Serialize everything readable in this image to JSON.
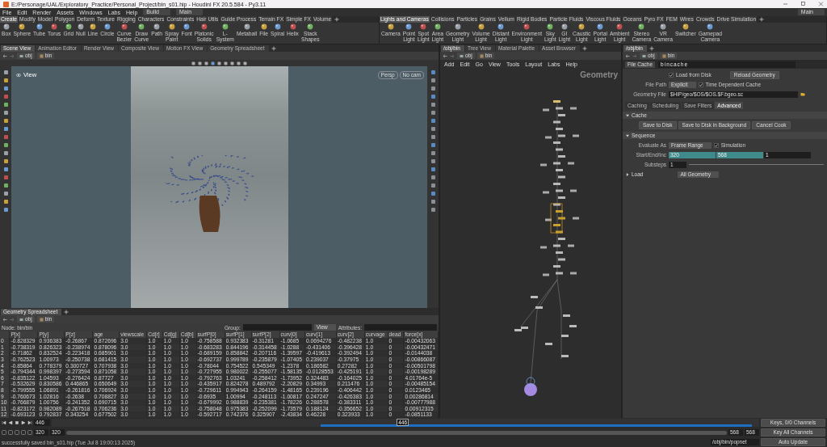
{
  "window": {
    "title": "E:/Personage/UAL/Exploratory_Practice/Personal_Project/bin_s01.hip - Houdini FX 20.5.584 - Py3.11"
  },
  "menu_bar": {
    "items": [
      "File",
      "Edit",
      "Render",
      "Assets",
      "Windows",
      "Labs",
      "Help"
    ],
    "desktop": "Build",
    "main_left": "Main",
    "main_right": "Main"
  },
  "shelves": [
    {
      "tabs": [
        {
          "label": "Create",
          "selected": true
        },
        {
          "label": "Modify",
          "selected": false
        },
        {
          "label": "Model",
          "selected": false
        },
        {
          "label": "Polygon",
          "selected": false
        },
        {
          "label": "Deform",
          "selected": false
        },
        {
          "label": "Texture",
          "selected": false
        },
        {
          "label": "Rigging",
          "selected": false
        },
        {
          "label": "Characters",
          "selected": false
        },
        {
          "label": "Constraints",
          "selected": false
        },
        {
          "label": "Hair Utils",
          "selected": false
        },
        {
          "label": "Guide Process",
          "selected": false
        },
        {
          "label": "Terrain FX",
          "selected": false
        },
        {
          "label": "Simple FX",
          "selected": false
        },
        {
          "label": "Volume",
          "selected": false
        }
      ],
      "tools": [
        "Box",
        "Sphere",
        "Tube",
        "Torus",
        "Grid",
        "Null",
        "Line",
        "Circle",
        "Curve Bezier",
        "Draw Curve",
        "Path",
        "Spray Paint",
        "Font",
        "Platonic Solids",
        "L-System",
        "Metaball",
        "File",
        "Spiral",
        "Helix",
        "Stack Shapes"
      ]
    },
    {
      "tabs": [
        {
          "label": "Lights and Cameras",
          "selected": true
        },
        {
          "label": "Collisions",
          "selected": false
        },
        {
          "label": "Particles",
          "selected": false
        },
        {
          "label": "Grains",
          "selected": false
        },
        {
          "label": "Vellum",
          "selected": false
        },
        {
          "label": "Rigid Bodies",
          "selected": false
        },
        {
          "label": "Particle Fluids",
          "selected": false
        },
        {
          "label": "Viscous Fluids",
          "selected": false
        },
        {
          "label": "Oceans",
          "selected": false
        },
        {
          "label": "Pyro FX",
          "selected": false
        },
        {
          "label": "FEM",
          "selected": false
        },
        {
          "label": "Wires",
          "selected": false
        },
        {
          "label": "Crowds",
          "selected": false
        },
        {
          "label": "Drive Simulation",
          "selected": false
        }
      ],
      "tools": [
        "Camera",
        "Point Light",
        "Spot Light",
        "Area Light",
        "Geometry Light",
        "Volume Light",
        "Distant Light",
        "Environment Light",
        "Sky Light",
        "GI Light",
        "Caustic Light",
        "Portal Light",
        "Ambient Light",
        "Stereo Camera",
        "VR Camera",
        "Switcher",
        "Gamepad Camera"
      ]
    }
  ],
  "scene_pane": {
    "tabs": [
      {
        "label": "Scene View",
        "selected": true
      },
      {
        "label": "Animation Editor",
        "selected": false
      },
      {
        "label": "Render View",
        "selected": false
      },
      {
        "label": "Composite View",
        "selected": false
      },
      {
        "label": "Motion FX View",
        "selected": false
      },
      {
        "label": "Geometry Spreadsheet",
        "selected": false
      }
    ],
    "path": [
      "obj",
      "bin"
    ],
    "view_label": "View",
    "view_menus": [
      "Persp",
      "No cam"
    ]
  },
  "spreadsheet": {
    "tabs": [
      {
        "label": "Geometry Spreadsheet",
        "selected": true
      }
    ],
    "path": [
      "obj",
      "bin"
    ],
    "node_label": "Node: bin/bin",
    "group_label": "Group:",
    "view_menu": "View",
    "attributes_label": "Attributes:",
    "columns": [
      "",
      "P[x]",
      "P[y]",
      "P[z]",
      "age",
      "viewscale",
      "Cd[r]",
      "Cd[g]",
      "Cd[b]",
      "surfP[0]",
      "surfP[1]",
      "surfP[2]",
      "curv[0]",
      "curv[1]",
      "curv[2]",
      "curvage",
      "dead",
      "force[x]"
    ],
    "rows": [
      [
        "0",
        "-0.828329",
        "0.936383",
        "-0.26867",
        "0.872696",
        "3.0",
        "1.0",
        "1.0",
        "1.0",
        "-0.758588",
        "0.932383",
        "-0.31281",
        "-1.0685",
        "0.0694276",
        "-0.482238",
        "1.0",
        "0",
        "-0.00432063"
      ],
      [
        "1",
        "-0.738319",
        "0.826323",
        "-0.238974",
        "0.878096",
        "3.0",
        "1.0",
        "1.0",
        "1.0",
        "-0.683283",
        "0.844196",
        "-0.314458",
        "-1.0288",
        "-0.431406",
        "-0.396428",
        "1.0",
        "0",
        "-0.00432471"
      ],
      [
        "2",
        "-0.71862",
        "0.832524",
        "-0.223418",
        "0.685901",
        "3.0",
        "1.0",
        "1.0",
        "1.0",
        "-0.689159",
        "0.858842",
        "-0.207116",
        "-1.39597",
        "-0.419613",
        "-0.392494",
        "1.0",
        "0",
        "-0.0144038"
      ],
      [
        "3",
        "-0.762523",
        "1.00973",
        "-0.250738",
        "0.681415",
        "3.0",
        "1.0",
        "1.0",
        "1.0",
        "-0.692737",
        "0.999789",
        "-0.235879",
        "-1.07405",
        "0.239037",
        "-0.37975",
        "1.0",
        "0",
        "-0.00866087"
      ],
      [
        "4",
        "-0.85864",
        "0.778379",
        "0.300727",
        "0.707938",
        "3.0",
        "1.0",
        "1.0",
        "1.0",
        "-0.78044",
        "0.754522",
        "0.545349",
        "-1.2378",
        "0.186582",
        "0.27282",
        "1.0",
        "0",
        "-0.00501798"
      ],
      [
        "5",
        "-0.794344",
        "0.998397",
        "-0.273594",
        "0.871058",
        "3.0",
        "1.0",
        "1.0",
        "1.0",
        "-0.727955",
        "0.980022",
        "-0.255077",
        "-1.58135",
        "-0.0128553",
        "-0.425191",
        "1.0",
        "0",
        "-0.00198289"
      ],
      [
        "6",
        "-0.835122",
        "1.04593",
        "-0.276424",
        "0.87727",
        "3.0",
        "1.0",
        "1.0",
        "1.0",
        "-0.792763",
        "1.03241",
        "-0.258412",
        "-1.73952",
        "0.324483",
        "-0.164025",
        "1.0",
        "0",
        "4.01764e-5"
      ],
      [
        "7",
        "-0.532629",
        "0.830586",
        "0.446865",
        "0.650649",
        "3.0",
        "1.0",
        "1.0",
        "1.0",
        "-0.435917",
        "0.824278",
        "0.489792",
        "-2.20829",
        "0.34993",
        "0.211476",
        "1.0",
        "0",
        "-0.00485154"
      ],
      [
        "8",
        "-0.799555",
        "1.06891",
        "-0.261816",
        "0.706924",
        "3.0",
        "1.0",
        "1.0",
        "1.0",
        "-0.729611",
        "0.994943",
        "-0.264159",
        "-1.48165",
        "0.239196",
        "-0.406442",
        "1.0",
        "0",
        "0.0123465"
      ],
      [
        "9",
        "-0.760673",
        "1.02816",
        "-0.2638",
        "0.708827",
        "3.0",
        "1.0",
        "1.0",
        "1.0",
        "-0.6935",
        "1.00994",
        "-0.248113",
        "-1.00817",
        "0.247247",
        "-0.426383",
        "1.0",
        "0",
        "0.00286814"
      ],
      [
        "10",
        "-0.766879",
        "1.00756",
        "-0.241352",
        "0.690715",
        "3.0",
        "1.0",
        "1.0",
        "1.0",
        "-0.679992",
        "0.988839",
        "-0.235381",
        "-1.78226",
        "0.288578",
        "-0.383311",
        "1.0",
        "0",
        "-0.00777988"
      ],
      [
        "11",
        "-0.823172",
        "0.982089",
        "-0.267518",
        "0.706236",
        "3.0",
        "1.0",
        "1.0",
        "1.0",
        "-0.758048",
        "0.975383",
        "-0.252099",
        "-1.73579",
        "0.188124",
        "-0.356652",
        "1.0",
        "0",
        "0.00912315"
      ],
      [
        "12",
        "-0.693123",
        "0.792837",
        "0.343254",
        "0.677502",
        "3.0",
        "1.0",
        "1.0",
        "1.0",
        "-0.592717",
        "0.742376",
        "0.325907",
        "-2.43834",
        "0.46228",
        "0.323933",
        "1.0",
        "0",
        "-0.0851133"
      ]
    ]
  },
  "network": {
    "tabs": [
      {
        "label": "/obj/bin",
        "selected": true
      },
      {
        "label": "Tree View",
        "selected": false
      },
      {
        "label": "Material Palette",
        "selected": false
      },
      {
        "label": "Asset Browser",
        "selected": false
      }
    ],
    "path": [
      "obj",
      "bin"
    ],
    "menu": [
      "Add",
      "Edit",
      "Go",
      "View",
      "Tools",
      "Layout",
      "Labs",
      "Help"
    ],
    "context_label": "Geometry"
  },
  "parameters": {
    "tabs": [
      {
        "label": "/obj/bin",
        "selected": true
      }
    ],
    "path": [
      "obj",
      "bin"
    ],
    "node_type": "File Cache",
    "node_name": "bincache",
    "load_from_disk": {
      "label": "Load from Disk",
      "checked": true
    },
    "reload_button": "Reload Geometry",
    "file_path": {
      "label": "File Path",
      "value": "Explicit"
    },
    "time_dependent": {
      "label": "Time Dependent Cache",
      "checked": true
    },
    "geometry_file": {
      "label": "Geometry File",
      "value": "$HIP/geo/$OS/$OS.$F.bgeo.sc"
    },
    "param_tabs": [
      {
        "label": "Caching",
        "selected": false
      },
      {
        "label": "Scheduling",
        "selected": false
      },
      {
        "label": "Save Filters",
        "selected": false
      },
      {
        "label": "Advanced",
        "selected": true
      }
    ],
    "sections": [
      {
        "kind": "buttons",
        "title": "Cache",
        "expanded": true,
        "buttons": [
          "Save to Disk",
          "Save to Disk in Background",
          "Cancel Cook"
        ]
      },
      {
        "kind": "sequence",
        "title": "Sequence",
        "expanded": true,
        "evaluate_label": "Evaluate As",
        "evaluate_value": "Frame Range",
        "simulation": {
          "label": "Simulation",
          "checked": true
        },
        "range_label": "Start/End/Inc",
        "range": [
          "320",
          "568",
          "1"
        ],
        "substeps_label": "Substeps",
        "substeps": "1"
      },
      {
        "kind": "menu",
        "title": "Load",
        "expanded": false,
        "value": "All Geometry"
      }
    ]
  },
  "timeline": {
    "current_frame": "446",
    "playhead_frame": "446",
    "range_slider": {
      "level": 1
    },
    "start": "320",
    "range_start": "320",
    "range_end": "568",
    "end": "568",
    "keys_button": "Keys, 0/0 Channels",
    "key_all_button": "Key All Channels",
    "status": "successfully saved bin_s01.hip (Tue Jul  8 19:00:13 2025)",
    "network_path": "/obj/bin/popnet",
    "update_button": "Auto Update"
  }
}
